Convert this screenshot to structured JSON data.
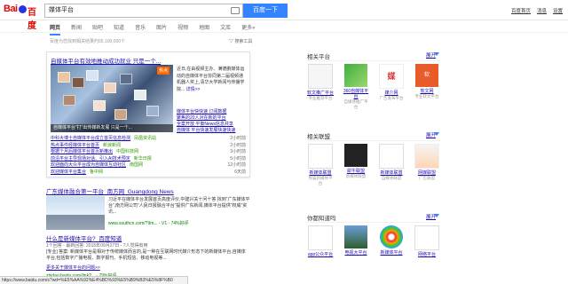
{
  "header": {
    "logo_text_left": "Bai",
    "logo_text_right": "百度",
    "search_value": "媒体平台",
    "search_button": "百度一下",
    "top_links": [
      "百度首页",
      "消息",
      "设置"
    ]
  },
  "tabs": [
    "网页",
    "新闻",
    "贴吧",
    "知道",
    "音乐",
    "图片",
    "视频",
    "地图",
    "文库",
    "更多»"
  ],
  "result_count": "百度为您找到相关结果约55,100,000个",
  "tools_label": "搜索工具",
  "card": {
    "title": "自媒体平台有效地推动成功就业 只是一个...",
    "hot_badge": "热点",
    "image_caption": "自媒体平台“打”出传媒新发展 只是一个...",
    "summary": "近日,在由视频主办、满德鹏媒体运动的自媒体平台协同第二届视频通机器人奖上,清华大学新闻与传播学院...",
    "summary_more": "详情>>",
    "links": [
      "媒体平台快快速 订阅数据",
      "聚焦的20人对在新的平台",
      "全案开放 平衡News信息共享",
      "自媒体 平台快速发展快速快速"
    ],
    "news": [
      {
        "title": "中科大博士自媒体平台成立首页信息检测",
        "source": "凤凰资讯站",
        "time": "2小时前"
      },
      {
        "title": "热点事件经媒体平台首页",
        "source": "新浪新闻",
        "time": "2小时前"
      },
      {
        "title": "根据个月后媒体平台首页新推出",
        "source": "中国科技网",
        "time": "3小时前"
      },
      {
        "title": "前沿平台主导现场对话、引入AI技术预定",
        "source": "新华日报",
        "time": "5小时前"
      },
      {
        "title": "欢迎面向大众平台成为自媒体互动社区",
        "source": "南国网",
        "time": "12小时前"
      },
      {
        "title": "欢迎媒体平台集合",
        "source": "鲁中网",
        "time": "6天前"
      }
    ]
  },
  "result2": {
    "title": "广东媒体融合第一平台_南方网_Guangdong News",
    "text": "习近平在媒体平台发展首页高度评价,中建兴关十问十答 找到“广东媒体平台”,南方网公司“人民日报融合平台”提供广东新闻,媒体平台提供“权威”资讯...",
    "url": "www.southcn.com/?9m... - V1 - 74%好评"
  },
  "result3": {
    "title": "什么是新媒体平台?_百度知道",
    "meta": "1个回答 - 最新回答: 2015年09月27日 - 7人觉得有用",
    "body": "[专业] 答案: 新媒体平台是相对于传统媒体而言的,是一种在互联网时代媒介形态下的新媒体平台,自媒体平台,包括数字广播电视、数字报刊、手机短信、移动电视等...",
    "more": "更多关于媒体平台的问题>>",
    "url": "zhidao.baidu.com/link?... - 79%好评"
  },
  "status_url": "https://www.baidu.com/s?wd=%E5%AA%92%E4%BD%93%E5%B9%B3%E5%8F%B0",
  "side1": {
    "title": "相关平台",
    "expand": "展开",
    "items": [
      {
        "label": "软文推广平台",
        "sub": "专业推荐平台"
      },
      {
        "label": "360自媒体平台",
        "sub": "自媒体推广平台"
      },
      {
        "label": "媒介网",
        "sub": "广告发布平台"
      },
      {
        "label": "软文网",
        "sub": "专业软文平台"
      }
    ]
  },
  "side2": {
    "title": "相关联盟",
    "expand": "展开",
    "items": [
      {
        "label": "新媒体联盟",
        "sub": "熊猫新媒体平台"
      },
      {
        "label": "犀牛联盟",
        "sub": "新媒体联盟"
      },
      {
        "label": "新媒体联盟",
        "sub": "自媒体联盟"
      },
      {
        "label": "网媒联盟",
        "sub": "广告联盟"
      }
    ]
  },
  "side3": {
    "title": "你都知道吗",
    "expand": "展开",
    "items": [
      {
        "label": "app公众平台",
        "sub": ""
      },
      {
        "label": "电视大平台",
        "sub": ""
      },
      {
        "label": "新媒体平台",
        "sub": ""
      },
      {
        "label": "网络平台",
        "sub": ""
      }
    ]
  }
}
